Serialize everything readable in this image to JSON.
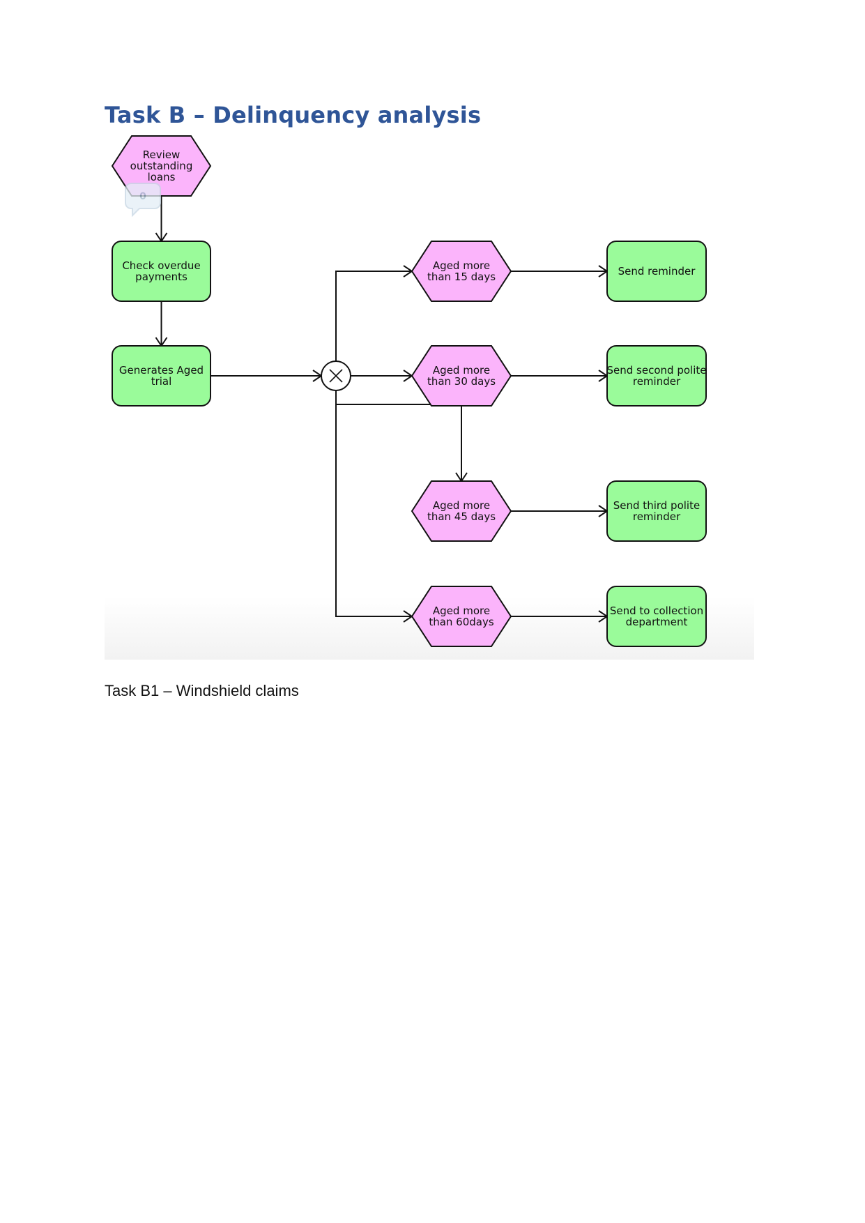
{
  "document": {
    "heading": "Task B – Delinquency analysis",
    "caption": "Task B1 – Windshield claims"
  },
  "diagram": {
    "colors": {
      "event_fill": "#FBB4FB",
      "function_fill": "#9AFB9A",
      "stroke": "#111111",
      "title": "#2F5597"
    },
    "comment_badge": {
      "icon": "comment-bubble-icon",
      "count": "0"
    },
    "nodes": [
      {
        "id": "review",
        "type": "event",
        "lines": [
          "Review",
          "outstanding",
          "loans"
        ]
      },
      {
        "id": "check",
        "type": "function",
        "lines": [
          "Check overdue",
          "payments"
        ]
      },
      {
        "id": "generate",
        "type": "function",
        "lines": [
          "Generates Aged",
          "trial"
        ]
      },
      {
        "id": "xor",
        "type": "xor-gateway",
        "lines": []
      },
      {
        "id": "aged15",
        "type": "event",
        "lines": [
          "Aged more",
          "than 15 days"
        ]
      },
      {
        "id": "aged30",
        "type": "event",
        "lines": [
          "Aged more",
          "than 30 days"
        ]
      },
      {
        "id": "aged45",
        "type": "event",
        "lines": [
          "Aged more",
          "than 45 days"
        ]
      },
      {
        "id": "aged60",
        "type": "event",
        "lines": [
          "Aged more",
          "than 60days"
        ]
      },
      {
        "id": "remind1",
        "type": "function",
        "lines": [
          "Send reminder"
        ]
      },
      {
        "id": "remind2",
        "type": "function",
        "lines": [
          "Send second polite",
          "reminder"
        ]
      },
      {
        "id": "remind3",
        "type": "function",
        "lines": [
          "Send third polite",
          "reminder"
        ]
      },
      {
        "id": "collect",
        "type": "function",
        "lines": [
          "Send to collection",
          "department"
        ]
      }
    ],
    "edges": [
      {
        "from": "review",
        "to": "check"
      },
      {
        "from": "check",
        "to": "generate"
      },
      {
        "from": "generate",
        "to": "xor"
      },
      {
        "from": "xor",
        "to": "aged15"
      },
      {
        "from": "xor",
        "to": "aged30"
      },
      {
        "from": "xor",
        "to": "aged45"
      },
      {
        "from": "xor",
        "to": "aged60"
      },
      {
        "from": "aged15",
        "to": "remind1"
      },
      {
        "from": "aged30",
        "to": "remind2"
      },
      {
        "from": "aged45",
        "to": "remind3"
      },
      {
        "from": "aged60",
        "to": "collect"
      }
    ]
  }
}
